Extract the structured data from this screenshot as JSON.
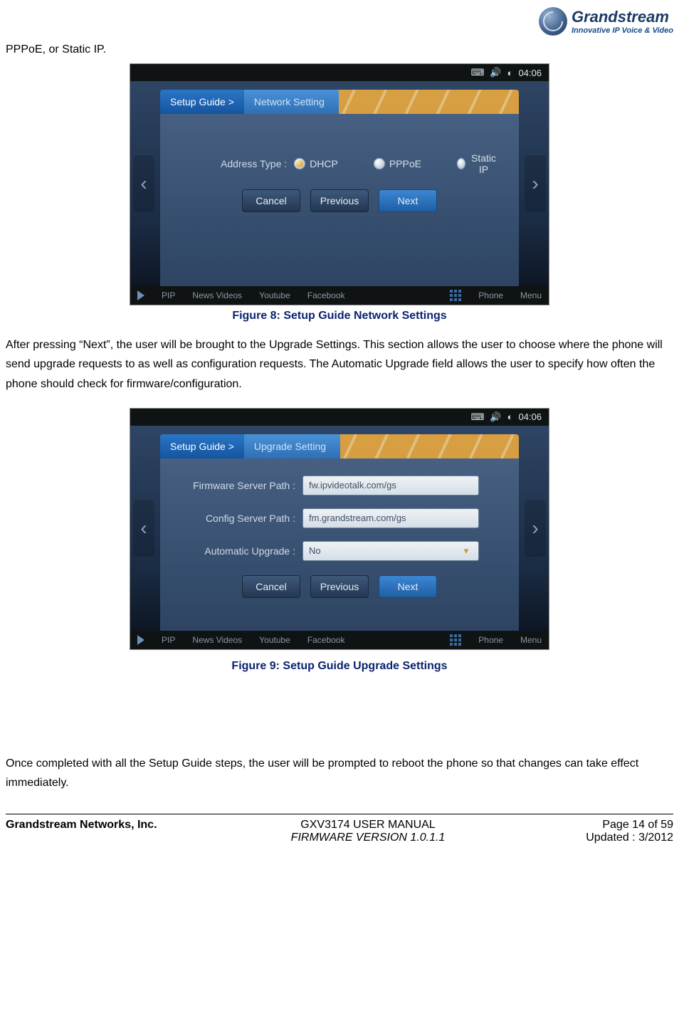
{
  "logo": {
    "name": "Grandstream",
    "tagline": "Innovative IP Voice & Video"
  },
  "intro_fragment": "PPPoE, or Static IP.",
  "fig8": {
    "caption": "Figure 8: Setup Guide Network Settings",
    "status_time": "04:06",
    "breadcrumb_main": "Setup Guide >",
    "breadcrumb_sub": "Network Setting",
    "address_label": "Address Type :",
    "options": {
      "dhcp": "DHCP",
      "pppoe": "PPPoE",
      "static": "Static IP"
    },
    "buttons": {
      "cancel": "Cancel",
      "previous": "Previous",
      "next": "Next"
    },
    "bottom": {
      "pip": "PIP",
      "news": "News Videos",
      "youtube": "Youtube",
      "facebook": "Facebook",
      "phone": "Phone",
      "menu": "Menu"
    }
  },
  "para_after_fig8": "After pressing “Next”, the user will be brought to the Upgrade Settings. This section allows the user to choose where the phone will send upgrade requests to as well as configuration requests.    The Automatic Upgrade field allows the user to specify how often the phone should check for firmware/configuration.",
  "fig9": {
    "caption": "Figure 9: Setup Guide Upgrade Settings",
    "status_time": "04:06",
    "breadcrumb_main": "Setup Guide >",
    "breadcrumb_sub": "Upgrade Setting",
    "fields": {
      "fw_label": "Firmware Server Path :",
      "fw_value": "fw.ipvideotalk.com/gs",
      "cfg_label": "Config Server Path :",
      "cfg_value": "fm.grandstream.com/gs",
      "auto_label": "Automatic Upgrade :",
      "auto_value": "No"
    },
    "buttons": {
      "cancel": "Cancel",
      "previous": "Previous",
      "next": "Next"
    },
    "bottom": {
      "pip": "PIP",
      "news": "News Videos",
      "youtube": "Youtube",
      "facebook": "Facebook",
      "phone": "Phone",
      "menu": "Menu"
    }
  },
  "para_after_fig9": "Once completed with all the    Setup Guide steps, the user will be prompted to reboot the phone so that changes can take effect immediately.",
  "footer": {
    "company": "Grandstream Networks, Inc.",
    "manual": "GXV3174 USER MANUAL",
    "page": "Page 14 of 59",
    "firmware": "FIRMWARE VERSION 1.0.1.1",
    "updated": "Updated : 3/2012"
  }
}
